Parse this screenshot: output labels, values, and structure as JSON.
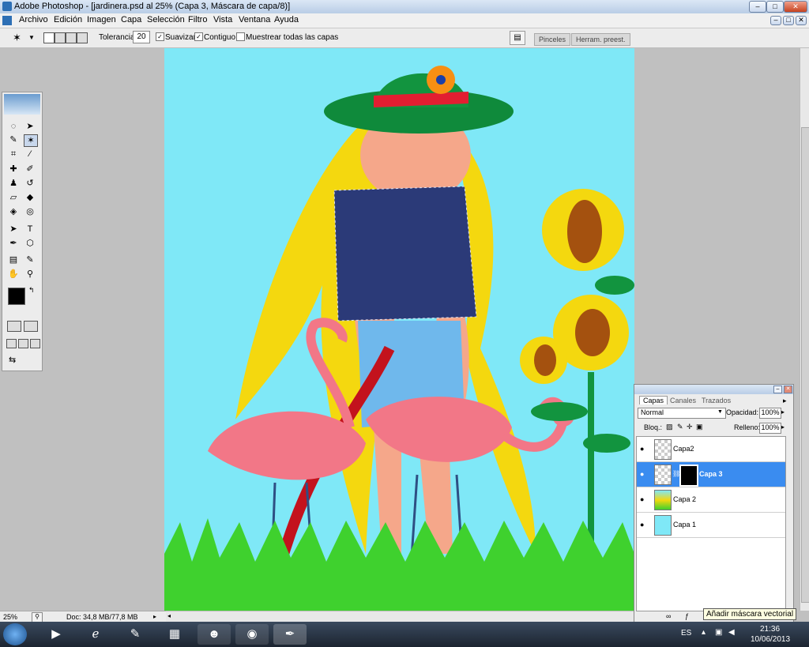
{
  "window": {
    "title": "Adobe Photoshop - [jardinera.psd al 25% (Capa 3, Máscara de capa/8)]",
    "min_symbol": "–",
    "max_symbol": "□",
    "close_symbol": "✕"
  },
  "menu": {
    "items": [
      "Archivo",
      "Edición",
      "Imagen",
      "Capa",
      "Selección",
      "Filtro",
      "Vista",
      "Ventana",
      "Ayuda"
    ]
  },
  "options": {
    "tolerance_label": "Tolerancia:",
    "tolerance_value": "20",
    "smooth_label": "Suavizar",
    "contiguous_label": "Contiguo",
    "sample_all_label": "Muestrear todas las capas"
  },
  "palette_well": {
    "tabs": [
      "Pinceles",
      "Herram. preest."
    ]
  },
  "layers_panel": {
    "tabs": [
      "Capas",
      "Canales",
      "Trazados"
    ],
    "blend_mode": "Normal",
    "opacity_label": "Opacidad:",
    "opacity_value": "100%",
    "lock_label": "Bloq.:",
    "fill_label": "Relleno:",
    "fill_value": "100%",
    "layers": [
      {
        "name": "Capa2",
        "selected": false
      },
      {
        "name": "Capa 3",
        "selected": true
      },
      {
        "name": "Capa 2",
        "selected": false
      },
      {
        "name": "Capa 1",
        "selected": false
      }
    ]
  },
  "status": {
    "zoom": "25%",
    "doc_info": "Doc: 34,8 MB/77,8 MB"
  },
  "tooltip": {
    "text": "Añadir máscara vectorial"
  },
  "taskbar": {
    "language": "ES",
    "time": "21:36",
    "date": "10/06/2013"
  },
  "colors": {
    "canvas_bg": "#7fe8f7",
    "selected_layer": "#3a8cf0",
    "foreground": "#000000",
    "background": "#ffffff"
  }
}
